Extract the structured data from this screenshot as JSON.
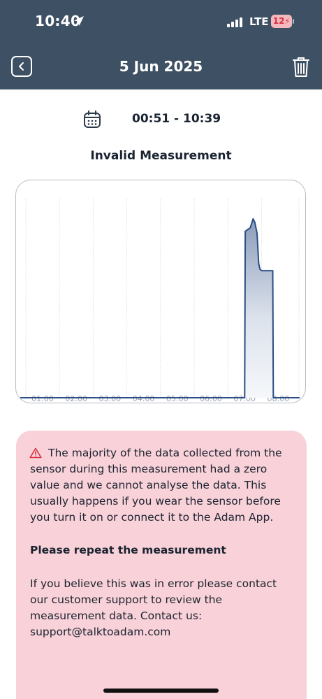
{
  "status_bar": {
    "time": "10:40",
    "network": "LTE",
    "battery": "12"
  },
  "header": {
    "title": "5 Jun 2025"
  },
  "icons": [
    "location-arrow-icon",
    "signal-icon",
    "battery-icon",
    "chevron-left-icon",
    "trash-icon",
    "calendar-icon",
    "warning-icon"
  ],
  "colors": {
    "header_bg": "#3e5063",
    "chart_line": "#2a4d86",
    "warning_bg": "#f9d1d8",
    "warning_icon": "#d8303f"
  },
  "measurement": {
    "time_range": "00:51 - 10:39",
    "status": "Invalid Measurement"
  },
  "chart_data": {
    "type": "area",
    "x_ticks": [
      "01:00",
      "02:00",
      "03:00",
      "04:00",
      "05:00",
      "06:00",
      "07:00",
      "08:00"
    ],
    "x": [
      "00:51",
      "07:30",
      "07:31",
      "07:40",
      "07:45",
      "07:48",
      "07:52",
      "07:55",
      "07:57",
      "08:00",
      "08:05",
      "08:15",
      "08:20",
      "08:21",
      "08:30"
    ],
    "values": [
      0,
      0,
      0.93,
      0.95,
      1.0,
      0.98,
      0.92,
      0.75,
      0.72,
      0.71,
      0.71,
      0.71,
      0.71,
      0,
      0
    ],
    "title": "",
    "xlabel": "",
    "ylabel": "",
    "grid": true
  },
  "warning": {
    "lines": [
      "The majority of the data collected from the",
      "sensor during this measurement had a zero",
      "value and we cannot analyse the data. This",
      "usually happens if you wear the sensor before",
      "you turn it on or connect it to the Adam App."
    ],
    "repeat": "Please repeat the measurement",
    "contact_lines": [
      "If you believe this was in error please contact",
      "our customer support to review the",
      "measurement data. Contact us:",
      "support@talktoadam.com"
    ]
  }
}
